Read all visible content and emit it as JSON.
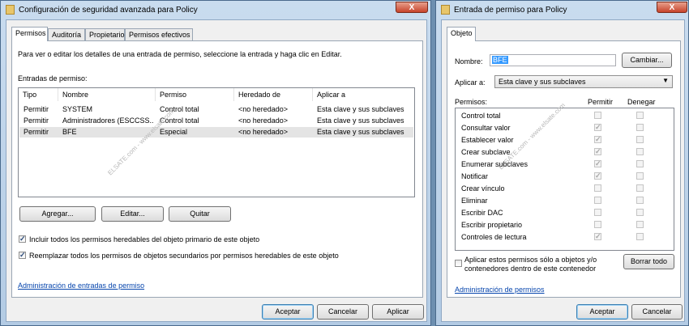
{
  "left": {
    "title": "Configuración de seguridad avanzada para Policy",
    "close": "X",
    "tabs": [
      "Permisos",
      "Auditoría",
      "Propietario",
      "Permisos efectivos"
    ],
    "instructions": "Para ver o editar los detalles de una entrada de permiso, seleccione la entrada y haga clic en Editar.",
    "entries_label": "Entradas de permiso:",
    "columns": [
      "Tipo",
      "Nombre",
      "Permiso",
      "Heredado de",
      "Aplicar a"
    ],
    "rows": [
      [
        "Permitir",
        "SYSTEM",
        "Control total",
        "<no heredado>",
        "Esta clave y sus subclaves"
      ],
      [
        "Permitir",
        "Administradores (ESCCSS...",
        "Control total",
        "<no heredado>",
        "Esta clave y sus subclaves"
      ],
      [
        "Permitir",
        "BFE",
        "Especial",
        "<no heredado>",
        "Esta clave y sus subclaves"
      ]
    ],
    "add_button": "Agregar...",
    "edit_button": "Editar...",
    "remove_button": "Quitar",
    "include_inheritable": "Incluir todos los permisos heredables del objeto primario de este objeto",
    "replace_child": "Reemplazar todos los permisos de objetos secundarios por permisos heredables de este objeto",
    "admin_link": "Administración de entradas de permiso",
    "ok_button": "Aceptar",
    "cancel_button": "Cancelar",
    "apply_button": "Aplicar",
    "watermark": "ELSATE.com - www.elsate.com"
  },
  "right": {
    "title": "Entrada de permiso para Policy",
    "close": "X",
    "tab": "Objeto",
    "name_label": "Nombre:",
    "name_value": "BFE",
    "change_button": "Cambiar...",
    "apply_label": "Aplicar a:",
    "apply_value": "Esta clave y sus subclaves",
    "permissions_label": "Permisos:",
    "allow_col": "Permitir",
    "deny_col": "Denegar",
    "permissions": [
      {
        "name": "Control total",
        "allow": false,
        "deny": false
      },
      {
        "name": "Consultar valor",
        "allow": true,
        "deny": false
      },
      {
        "name": "Establecer valor",
        "allow": true,
        "deny": false
      },
      {
        "name": "Crear subclave",
        "allow": true,
        "deny": false
      },
      {
        "name": "Enumerar subclaves",
        "allow": true,
        "deny": false
      },
      {
        "name": "Notificar",
        "allow": true,
        "deny": false
      },
      {
        "name": "Crear vínculo",
        "allow": false,
        "deny": false
      },
      {
        "name": "Eliminar",
        "allow": false,
        "deny": false
      },
      {
        "name": "Escribir DAC",
        "allow": false,
        "deny": false
      },
      {
        "name": "Escribir propietario",
        "allow": false,
        "deny": false
      },
      {
        "name": "Controles de lectura",
        "allow": true,
        "deny": false
      }
    ],
    "apply_only_line1": "Aplicar estos permisos sólo a objetos y/o",
    "apply_only_line2": "contenedores dentro de este contenedor",
    "clear_all_button": "Borrar todo",
    "admin_link": "Administración de permisos",
    "ok_button": "Aceptar",
    "cancel_button": "Cancelar",
    "watermark": "ELSATE.com - www.elsate.com"
  }
}
